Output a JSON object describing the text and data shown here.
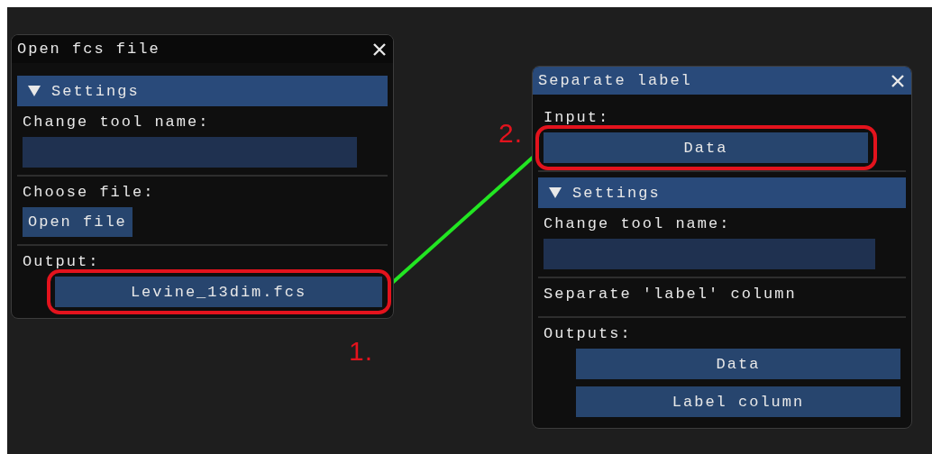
{
  "nodes": [
    {
      "title": "Open fcs file",
      "focused": false,
      "items": [
        {
          "kind": "header",
          "label": "Settings",
          "expanded": true
        },
        {
          "kind": "text",
          "text": "Change tool name:"
        },
        {
          "kind": "field"
        },
        {
          "kind": "divider"
        },
        {
          "kind": "text",
          "text": "Choose file:"
        },
        {
          "kind": "button",
          "label": "Open file"
        },
        {
          "kind": "divider"
        },
        {
          "kind": "text",
          "text": "Output:"
        },
        {
          "kind": "output",
          "label": "Levine_13dim.fcs",
          "connected": true,
          "highlighted": true,
          "marker": "1."
        }
      ]
    },
    {
      "title": "Separate label",
      "focused": true,
      "items": [
        {
          "kind": "text",
          "text": "Input:"
        },
        {
          "kind": "input",
          "label": "Data",
          "connected": true,
          "highlighted": true,
          "marker": "2."
        },
        {
          "kind": "divider"
        },
        {
          "kind": "header",
          "label": "Settings",
          "expanded": true
        },
        {
          "kind": "text",
          "text": "Change tool name:"
        },
        {
          "kind": "field"
        },
        {
          "kind": "divider"
        },
        {
          "kind": "text",
          "text": "Separate 'label' column"
        },
        {
          "kind": "divider"
        },
        {
          "kind": "text",
          "text": "Outputs:"
        },
        {
          "kind": "output",
          "label": "Data",
          "highlighted": false
        },
        {
          "kind": "output",
          "label": "Label column",
          "highlighted": false
        }
      ]
    }
  ]
}
